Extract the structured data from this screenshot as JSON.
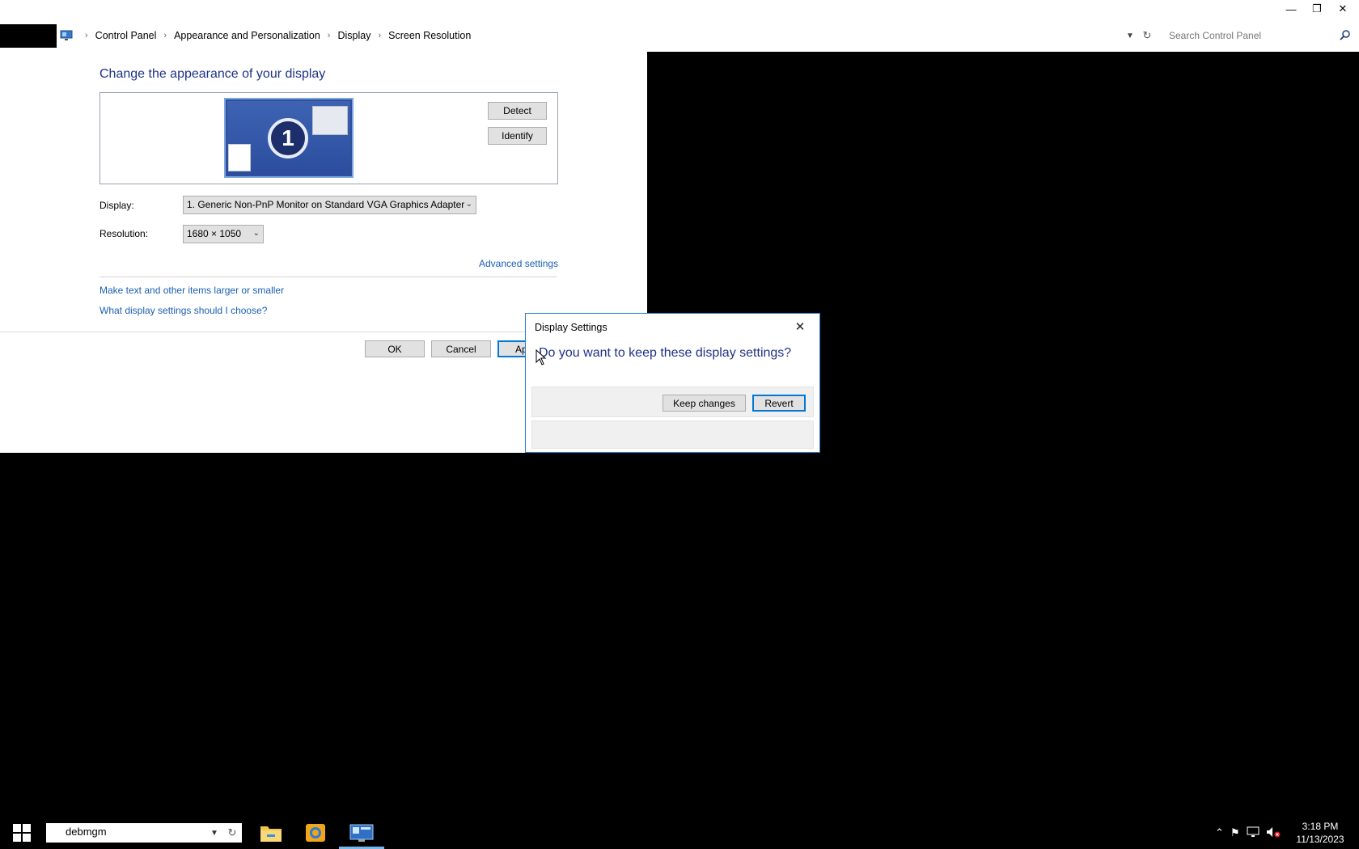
{
  "window": {
    "minimize_glyph": "—",
    "restore_glyph": "❐",
    "close_glyph": "✕"
  },
  "address_bar": {
    "breadcrumbs": [
      "Control Panel",
      "Appearance and Personalization",
      "Display",
      "Screen Resolution"
    ],
    "separator": "›",
    "search_placeholder": "Search Control Panel"
  },
  "main": {
    "heading": "Change the appearance of your display",
    "monitor_number": "1",
    "detect_label": "Detect",
    "identify_label": "Identify",
    "display_label": "Display:",
    "display_value": "1. Generic Non-PnP Monitor on Standard VGA Graphics Adapter",
    "resolution_label": "Resolution:",
    "resolution_value": "1680 × 1050",
    "advanced_settings": "Advanced settings",
    "link_text_size": "Make text and other items larger or smaller",
    "link_which_settings": "What display settings should I choose?",
    "ok_label": "OK",
    "cancel_label": "Cancel",
    "apply_label": "Ap"
  },
  "dialog": {
    "title": "Display Settings",
    "question": "Do you want to keep these display settings?",
    "keep_label": "Keep changes",
    "revert_label": "Revert"
  },
  "taskbar": {
    "input_value": "debmgm",
    "clock_time": "3:18 PM",
    "clock_date": "11/13/2023"
  },
  "icons": [
    "control-panel-icon",
    "search-icon",
    "windows-start-icon",
    "file-explorer-icon",
    "app-icon",
    "display-settings-icon",
    "chevron-up-icon",
    "flag-icon",
    "network-icon",
    "volume-muted-icon"
  ]
}
